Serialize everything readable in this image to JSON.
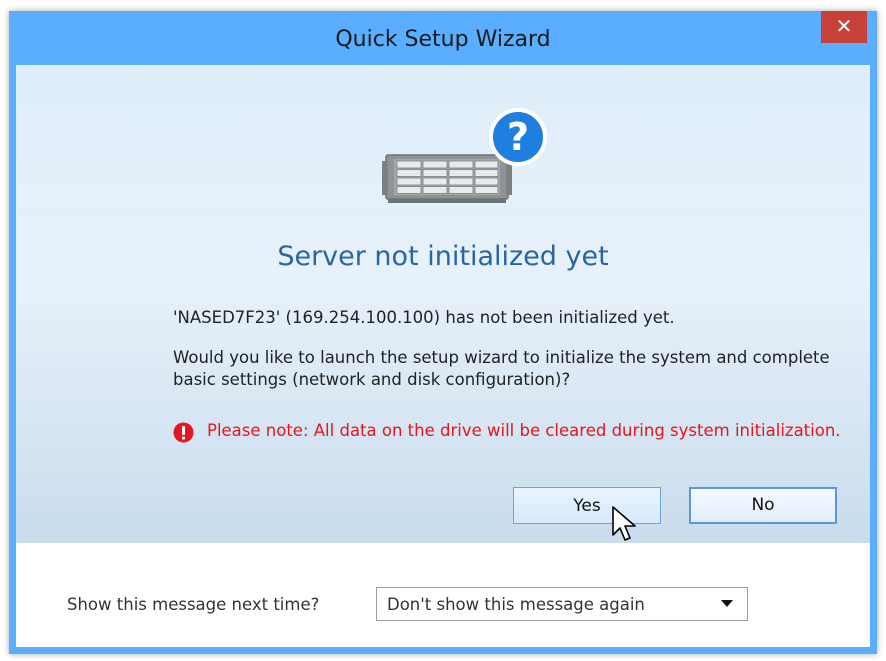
{
  "window": {
    "title": "Quick Setup Wizard",
    "close_glyph": "✕"
  },
  "dialog": {
    "headline": "Server not initialized yet",
    "message_1": "'NASED7F23' (169.254.100.100) has not been initialized yet.",
    "message_2": "Would you like to launch the setup wizard to initialize the system and complete basic settings (network and disk configuration)?",
    "warning_icon": "exclamation-circle-icon",
    "warning": "Please note: All data on the drive will be cleared during system initialization.",
    "yes_label": "Yes",
    "no_label": "No"
  },
  "footer": {
    "label": "Show this message next time?",
    "select_value": "Don't show this message again"
  },
  "colors": {
    "title_bar": "#5aaeff",
    "close_button": "#c7403a",
    "headline": "#2a64a8",
    "warning": "#e8141e",
    "help_badge": "#1e7fe0"
  },
  "icons": {
    "device": "nas-server-icon",
    "help": "question-mark-icon",
    "cursor": "mouse-pointer-icon"
  }
}
